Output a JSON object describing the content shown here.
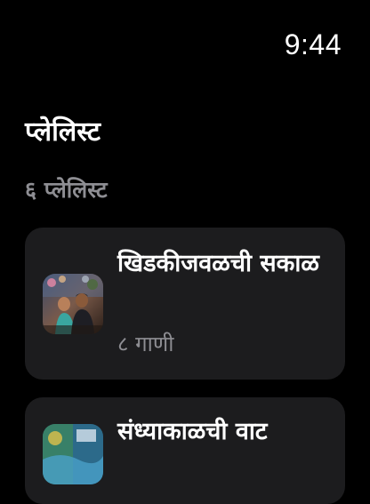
{
  "status_bar": {
    "time": "9:44"
  },
  "header": {
    "title": "प्लेलिस्ट",
    "count": "६ प्लेलिस्ट"
  },
  "playlists": [
    {
      "title": "खिडकीजवळची सकाळ",
      "subtitle": "८ गाणी",
      "thumbnail": "couple-city-photo"
    },
    {
      "title": "संध्याकाळची वाट",
      "thumbnail": "street-mural-photo"
    }
  ],
  "colors": {
    "background": "#000000",
    "card": "#1c1c1e",
    "secondary_text": "#8e8e93"
  }
}
